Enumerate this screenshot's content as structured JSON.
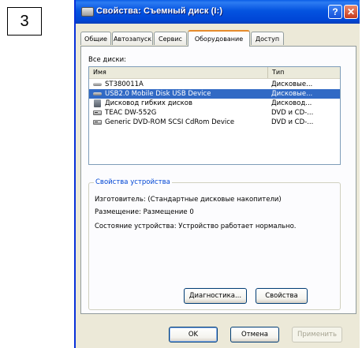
{
  "step_number": "3",
  "window": {
    "title": "Свойства: Съемный диск (I:)",
    "help_label": "?",
    "close_label": "✕"
  },
  "tabs": [
    {
      "label": "Общие"
    },
    {
      "label": "Автозапуск"
    },
    {
      "label": "Сервис"
    },
    {
      "label": "Оборудование",
      "active": true
    },
    {
      "label": "Доступ"
    }
  ],
  "disks": {
    "section_label": "Все диски:",
    "columns": {
      "name": "Имя",
      "type": "Тип"
    },
    "rows": [
      {
        "name": "ST380011A",
        "type": "Дисковые...",
        "icon": "hard-disk-icon"
      },
      {
        "name": "USB2.0 Mobile Disk USB Device",
        "type": "Дисковые...",
        "icon": "hard-disk-icon",
        "selected": true
      },
      {
        "name": "Дисковод гибких дисков",
        "type": "Дисковод...",
        "icon": "floppy-drive-icon"
      },
      {
        "name": "TEAC DW-552G",
        "type": "DVD и CD-...",
        "icon": "cd-drive-icon"
      },
      {
        "name": "Generic DVD-ROM SCSI CdRom Device",
        "type": "DVD и CD-...",
        "icon": "cd-drive-icon"
      }
    ]
  },
  "device_properties": {
    "title": "Свойства устройства",
    "manufacturer": "Изготовитель: (Стандартные дисковые накопители)",
    "location": "Размещение: Размещение 0",
    "status": "Состояние устройства: Устройство работает нормально."
  },
  "buttons": {
    "diagnostics": "Диагностика...",
    "properties": "Свойства",
    "ok": "OK",
    "cancel": "Отмена",
    "apply": "Применить"
  },
  "colors": {
    "titlebar": "#0453e0",
    "selection": "#316ac5",
    "active_tab_accent": "#e68b2c",
    "groupbox_title": "#0046d5",
    "dialog_face": "#ece9d8"
  }
}
